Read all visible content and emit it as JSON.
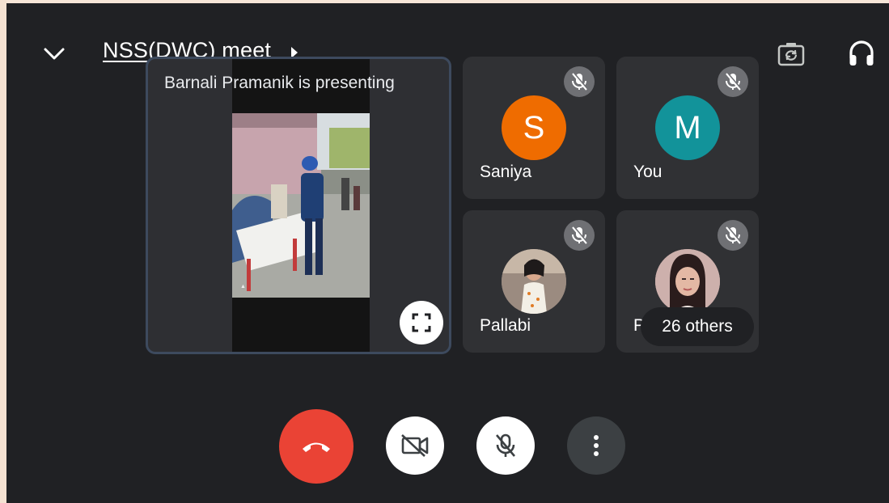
{
  "header": {
    "meeting_title": "NSS(DWC) meet"
  },
  "icons": {
    "collapse": "chevron-down-icon",
    "title_arrow": "caret-right-icon",
    "switch_camera": "camera-flip-icon",
    "audio_output": "headphones-icon",
    "fullscreen": "fullscreen-icon",
    "muted": "mic-off-icon",
    "end_call": "phone-hangup-icon",
    "camera": "video-off-icon",
    "microphone": "mic-off-icon",
    "more": "more-vert-icon"
  },
  "presentation": {
    "label": "Barnali Pramanik is presenting"
  },
  "participants": [
    {
      "name": "Saniya",
      "initial": "S",
      "avatar_color": "#ef6c00",
      "muted": true
    },
    {
      "name": "You",
      "initial": "M",
      "avatar_color": "#12939a",
      "muted": true
    },
    {
      "name": "Pallabi",
      "initial": "",
      "avatar_color": "#b0a0a0",
      "muted": true
    },
    {
      "name": "P",
      "initial": "",
      "avatar_color": "#c9a9a6",
      "muted": true
    }
  ],
  "overflow": {
    "label": "26 others"
  },
  "colors": {
    "end_call": "#ea4335",
    "background": "#202124",
    "tile": "#303134"
  }
}
